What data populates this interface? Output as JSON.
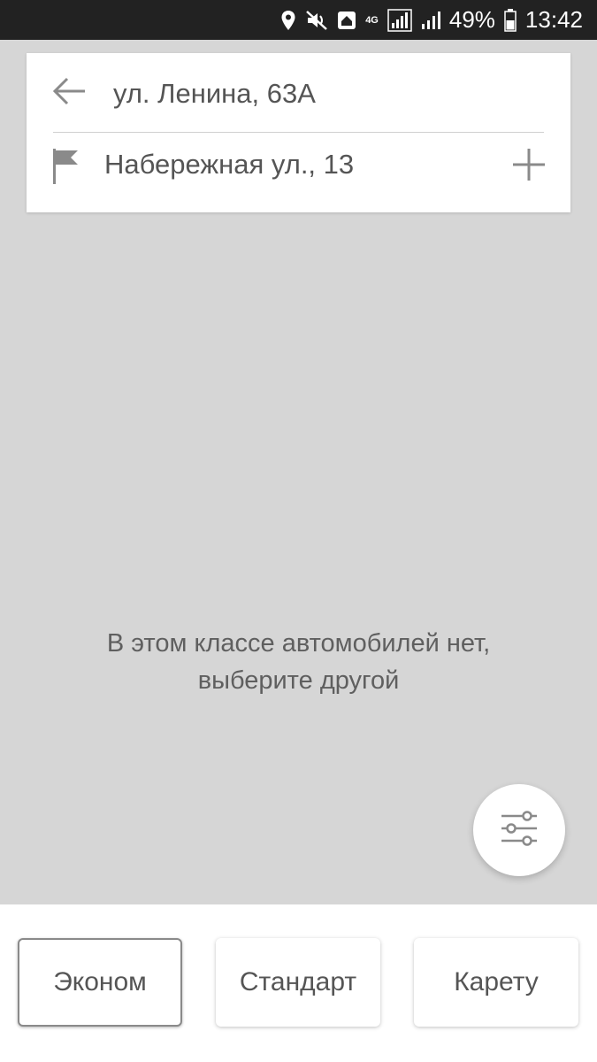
{
  "status_bar": {
    "battery_percent": "49%",
    "time": "13:42",
    "network": "4G",
    "icons": [
      "location-icon",
      "mute-icon",
      "home-icon",
      "4g-icon",
      "signal-icon",
      "signal-icon",
      "battery-icon"
    ]
  },
  "route": {
    "from": "ул. Ленина, 63А",
    "to": "Набережная ул., 13"
  },
  "empty_state": {
    "line1": "В этом классе автомобилей нет,",
    "line2": "выберите другой"
  },
  "car_classes": {
    "selected": "Эконом",
    "items": [
      {
        "label": "Эконом"
      },
      {
        "label": "Стандарт"
      },
      {
        "label": "Карету"
      }
    ]
  },
  "colors": {
    "map_background": "#d6d6d6",
    "status_bar": "#222222",
    "text": "#555555"
  }
}
